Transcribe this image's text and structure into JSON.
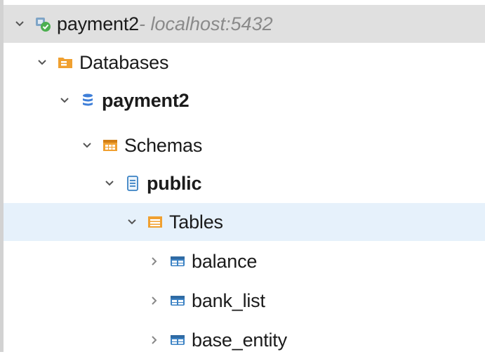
{
  "tree": {
    "connection": {
      "label": "payment2",
      "host": " - localhost:5432"
    },
    "databases": {
      "label": "Databases"
    },
    "database": {
      "label": "payment2"
    },
    "schemas": {
      "label": "Schemas"
    },
    "schema": {
      "label": "public"
    },
    "tables": {
      "label": "Tables"
    },
    "table_items": [
      {
        "label": "balance"
      },
      {
        "label": "bank_list"
      },
      {
        "label": "base_entity"
      }
    ]
  },
  "colors": {
    "connection_row_bg": "#e0e0e0",
    "tables_row_bg": "#e6f1fb",
    "folder_orange": "#f0a030",
    "db_blue": "#3f7fd8",
    "table_blue": "#3b82c4"
  }
}
